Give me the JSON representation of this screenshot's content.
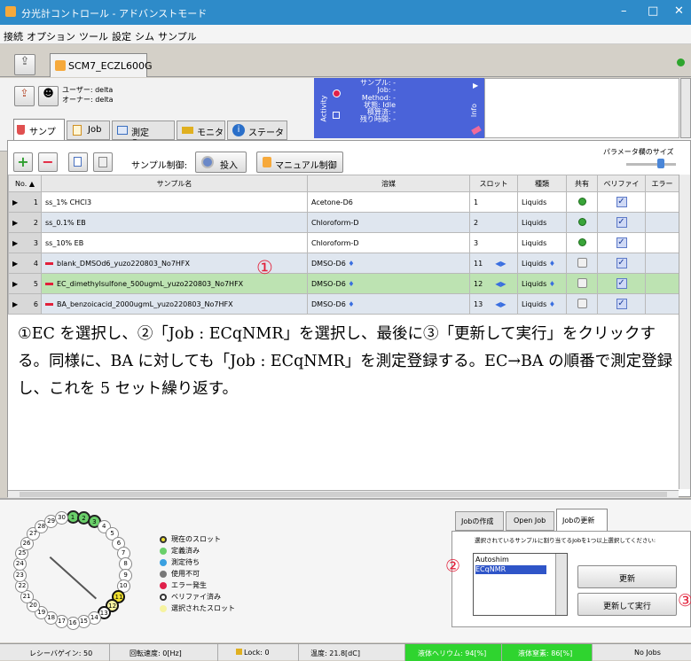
{
  "window": {
    "title": "分光計コントロール - アドバンストモード",
    "minimize": "–",
    "maximize": "□",
    "close": "✕"
  },
  "menu": [
    "接続",
    "オプション",
    "ツール",
    "設定",
    "シム",
    "サンプル"
  ],
  "spectrometer_tab": "SCM7_ECZL600G",
  "users": {
    "user": "ユーザー: delta",
    "owner": "オーナー: delta"
  },
  "activity": {
    "label": "Activity",
    "sample": "サンプル: -",
    "job": "Job: -",
    "method": "Method: -",
    "state": "状態: Idle",
    "accumulated": "積算済: -",
    "remaining": "残り時間: -"
  },
  "info_label": "Info",
  "tabs": [
    "サンプル",
    "Job",
    "測定Queue",
    "モニタ",
    "ステータス"
  ],
  "toolbar": {
    "sample_control": "サンプル制御:",
    "insert": "投入",
    "manual": "マニュアル制御",
    "param_width": "パラメータ欄のサイズ"
  },
  "columns": [
    "No.",
    "サンプル名",
    "溶媒",
    "スロット",
    "種類",
    "共有",
    "ベリファイ",
    "エラー"
  ],
  "rows": [
    {
      "no": "1",
      "name": "ss_1% CHCl3",
      "solvent": "Acetone-D6",
      "slot": "1",
      "type": "Liquids",
      "shared": "green"
    },
    {
      "no": "2",
      "name": "ss_0.1% EB",
      "solvent": "Chloroform-D",
      "slot": "2",
      "type": "Liquids",
      "shared": "green"
    },
    {
      "no": "3",
      "name": "ss_10% EB",
      "solvent": "Chloroform-D",
      "slot": "3",
      "type": "Liquids",
      "shared": "green"
    },
    {
      "no": "4",
      "name": "blank_DMSOd6_yuzo220803_No7HFX",
      "solvent": "DMSO-D6",
      "slot": "11",
      "type": "Liquids",
      "shared": "box"
    },
    {
      "no": "5",
      "name": "EC_dimethylsulfone_500ugmL_yuzo220803_No7HFX",
      "solvent": "DMSO-D6",
      "slot": "12",
      "type": "Liquids",
      "shared": "box"
    },
    {
      "no": "6",
      "name": "BA_benzoicacid_2000ugmL_yuzo220803_No7HFX",
      "solvent": "DMSO-D6",
      "slot": "13",
      "type": "Liquids",
      "shared": "box"
    }
  ],
  "annotation": {
    "marker1": "①",
    "text": "①EC を選択し、②「Job : ECqNMR」を選択し、最後に③「更新して実行」をクリックする。同様に、BA に対しても「Job : ECqNMR」を測定登録する。EC→BA の順番で測定登録し、これを 5 セット繰り返す。",
    "marker2": "②",
    "marker3": "③"
  },
  "legend": [
    "現在のスロット",
    "定義済み",
    "測定待ち",
    "使用不可",
    "エラー発生",
    "ベリファイ済み",
    "選択されたスロット"
  ],
  "legend_colors": [
    "#f0e030",
    "#6ad06a",
    "#3aa0e0",
    "#777777",
    "#e0204a",
    "#ffffff",
    "#f6f3a0"
  ],
  "job_tabs": [
    "Jobの作成",
    "Open Job",
    "Jobの更新"
  ],
  "job_panel": {
    "instruction": "選択されているサンプルに割り当てるJobを1つ以上選択してください:",
    "jobs": [
      "Autoshim",
      "ECqNMR"
    ],
    "update": "更新",
    "update_run": "更新して実行"
  },
  "statusbar": {
    "recipe": "レシーバゲイン: 50",
    "spin": "回転速度: 0[Hz]",
    "lock": "Lock: 0",
    "temp": "温度: 21.8[dC]",
    "helium": "液体ヘリウム: 94[%]",
    "nitrogen": "液体窒素: 86[%]",
    "jobs": "No Jobs"
  }
}
